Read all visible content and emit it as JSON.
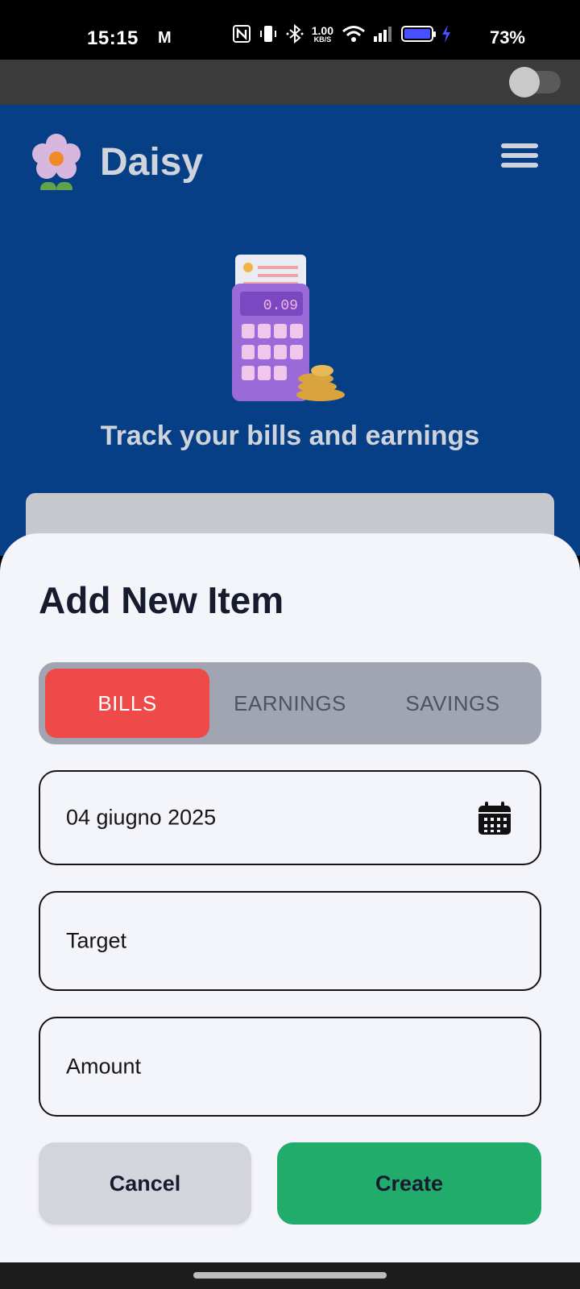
{
  "status_bar": {
    "time": "15:15",
    "mail_glyph": "M",
    "net_speed_value": "1.00",
    "net_speed_unit": "KB/S",
    "battery": "73%",
    "icons": [
      "nfc-icon",
      "vibrate-icon",
      "bluetooth-icon",
      "wifi-icon",
      "signal-icon",
      "battery-icon",
      "charging-icon"
    ]
  },
  "theme_toggle": {
    "state": "off"
  },
  "header": {
    "app_name": "Daisy",
    "tagline": "Track your bills and earnings",
    "calculator_display": "0.09"
  },
  "sheet": {
    "title": "Add New Item",
    "tabs": [
      {
        "label": "BILLS",
        "active": true
      },
      {
        "label": "EARNINGS",
        "active": false
      },
      {
        "label": "SAVINGS",
        "active": false
      }
    ],
    "date_value": "04 giugno 2025",
    "target_placeholder": "Target",
    "amount_placeholder": "Amount",
    "cancel_label": "Cancel",
    "create_label": "Create"
  },
  "colors": {
    "header_bg": "#063f86",
    "active_tab": "#ef4a4a",
    "create_button": "#22ac6c",
    "cancel_button": "#d3d4dc",
    "sheet_bg": "#f4f5fb"
  }
}
